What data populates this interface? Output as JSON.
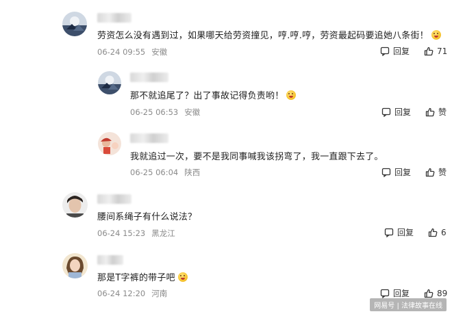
{
  "comments": [
    {
      "text": "劳资怎么没有遇到过，如果哪天给劳资撞见，哼.哼.哼，劳资最起码要追她八条街！",
      "date": "06-24 09:55",
      "location": "安徽",
      "reply_label": "回复",
      "like_count": "71",
      "emoji": "laughing-emoji"
    },
    {
      "text": "那不就追尾了？出了事故记得负责哟！",
      "date": "06-25 06:53",
      "location": "安徽",
      "reply_label": "回复",
      "like_count": "赞",
      "emoji": "tongue-emoji"
    },
    {
      "text": "我就追过一次，要不是我同事喊我该拐弯了，我一直跟下去了。",
      "date": "06-25 06:04",
      "location": "陕西",
      "reply_label": "回复",
      "like_count": "赞"
    },
    {
      "text": "腰间系绳子有什么说法？",
      "date": "06-24 15:23",
      "location": "黑龙江",
      "reply_label": "回复",
      "like_count": "6"
    },
    {
      "text": "那是T字裤的带子吧",
      "date": "06-24 12:20",
      "location": "河南",
      "reply_label": "回复",
      "like_count": "89",
      "emoji": "grin-emoji"
    }
  ],
  "watermark": "网易号 | 法律故事在线",
  "colors": {
    "text": "#1f1f1f",
    "meta": "#8a8a8a",
    "icon": "#333333"
  }
}
